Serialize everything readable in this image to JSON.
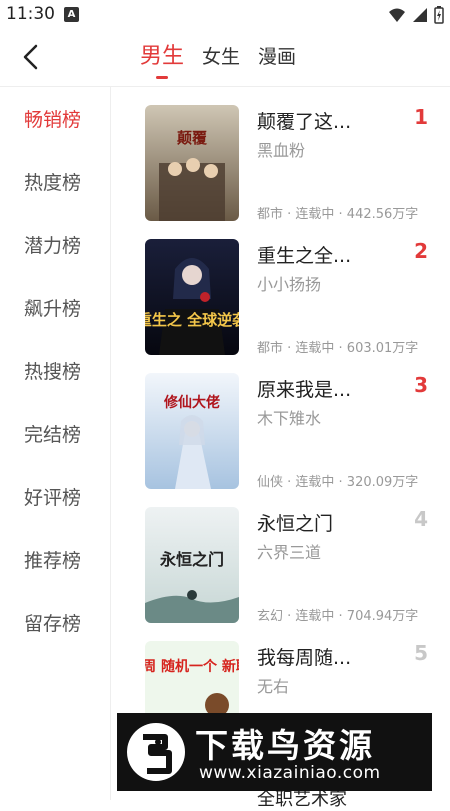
{
  "status": {
    "time": "11:30",
    "notice_glyph": "A"
  },
  "header": {
    "tabs": [
      {
        "label": "男生",
        "active": true
      },
      {
        "label": "女生",
        "active": false
      },
      {
        "label": "漫画",
        "active": false
      }
    ]
  },
  "sidebar": {
    "items": [
      {
        "label": "畅销榜",
        "active": true
      },
      {
        "label": "热度榜"
      },
      {
        "label": "潜力榜"
      },
      {
        "label": "飙升榜"
      },
      {
        "label": "热搜榜"
      },
      {
        "label": "完结榜"
      },
      {
        "label": "好评榜"
      },
      {
        "label": "推荐榜"
      },
      {
        "label": "留存榜"
      }
    ]
  },
  "books": [
    {
      "title": "颠覆了这...",
      "author": "黑血粉",
      "meta": "都市 · 连载中 · 442.56万字",
      "rank": "1",
      "cover_text": "颠覆"
    },
    {
      "title": "重生之全...",
      "author": "小小扬扬",
      "meta": "都市 · 连载中 · 603.01万字",
      "rank": "2",
      "cover_text": "重生之 全球逆袭"
    },
    {
      "title": "原来我是...",
      "author": "木下雉水",
      "meta": "仙侠 · 连载中 · 320.09万字",
      "rank": "3",
      "cover_text": "修仙大佬"
    },
    {
      "title": "永恒之门",
      "author": "六界三道",
      "meta": "玄幻 · 连载中 · 704.94万字",
      "rank": "4",
      "cover_text": "永恒之门"
    },
    {
      "title": "我每周随...",
      "author": "无右",
      "meta": "",
      "rank": "5",
      "cover_text": "我每周 随机一个 新职业"
    }
  ],
  "peek": {
    "title": "全职艺术家"
  },
  "watermark": {
    "brand": "下载鸟资源",
    "url": "www.xiazainiao.com"
  },
  "colors": {
    "accent": "#e23a3a",
    "muted": "#999999"
  }
}
